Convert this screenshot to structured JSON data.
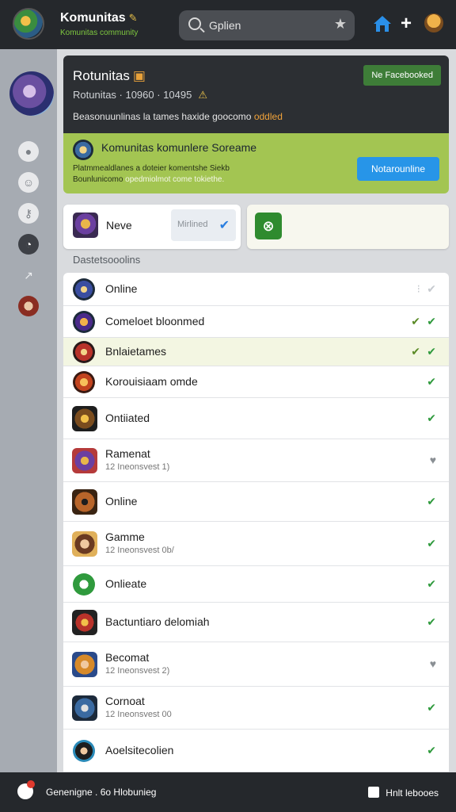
{
  "header": {
    "title": "Komunitas",
    "subtitle": "Komunitas community",
    "search_placeholder": "Gplien"
  },
  "hero": {
    "title": "Rotunitas",
    "meta": "Rotunitas · 10960 · 10495",
    "description": "Beasonuunlinas la tames haxide goocomo",
    "description_highlight": "oddled",
    "button": "Ne Facebooked"
  },
  "promo": {
    "title": "Komunitas komunlere Soreame",
    "description_1": "Platmmealdlanes a doteier komentshe Siekb",
    "description_2": "Bounlunicomo",
    "description_highlight": "opedmiolmot come tokiethe.",
    "button": "Notarounline"
  },
  "cards": {
    "game_label": "Neve",
    "select_value": "Mirlined"
  },
  "section_label": "Dastetsooolins",
  "list": [
    {
      "title": "Online",
      "sub": "",
      "status": "pale"
    },
    {
      "title": "Comeloet bloonmed",
      "sub": "",
      "status": "green-pair"
    },
    {
      "title": "Bnlaietames",
      "sub": "",
      "status": "highlight-pair"
    },
    {
      "title": "Korouisiaam omde",
      "sub": "",
      "status": "green"
    },
    {
      "title": "Ontiiated",
      "sub": "",
      "status": "green"
    },
    {
      "title": "Ramenat",
      "sub": "12 Ineonsvest 1)",
      "status": "gray"
    },
    {
      "title": "Online",
      "sub": "",
      "status": "green"
    },
    {
      "title": "Gamme",
      "sub": "12 Ineonsvest 0b/",
      "status": "green"
    },
    {
      "title": "Onlieate",
      "sub": "",
      "status": "green"
    },
    {
      "title": "Bactuntiaro delomiah",
      "sub": "",
      "status": "green"
    },
    {
      "title": "Becomat",
      "sub": "12 Ineonsvest 2)",
      "status": "gray"
    },
    {
      "title": "Cornoat",
      "sub": "12 Ineonsvest 00",
      "status": "green"
    },
    {
      "title": "Aoelsitecolien",
      "sub": "",
      "status": "green"
    }
  ],
  "footer": {
    "left": "Genenigne . 6o Hlobunieg",
    "right": "Hnlt lebooes"
  }
}
